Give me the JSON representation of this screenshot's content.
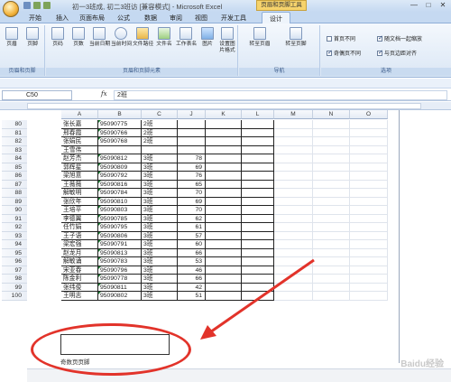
{
  "window": {
    "title": "初一3班成, 初二3班访 [兼容模式] - Microsoft Excel",
    "context_tab_title": "页眉和页脚工具",
    "min": "—",
    "max": "□",
    "close": "✕"
  },
  "tabs": [
    "开始",
    "插入",
    "页面布局",
    "公式",
    "数据",
    "审阅",
    "视图",
    "开发工具",
    "设计"
  ],
  "ribbon": {
    "groups": {
      "hf_label": "页眉和页脚",
      "elements_label": "页眉和页脚元素",
      "nav_label": "导航",
      "options_label": "选项"
    },
    "hf_buttons": [
      "页眉",
      "页脚"
    ],
    "element_buttons": [
      "页码",
      "页数",
      "当前日期",
      "当前时间",
      "文件路径",
      "文件名",
      "工作表名",
      "图片",
      "设置图片格式"
    ],
    "nav_buttons": [
      "转至页眉",
      "转至页脚"
    ],
    "options": [
      {
        "label": "首页不同",
        "checked": false
      },
      {
        "label": "随文档一起缩放",
        "checked": true
      },
      {
        "label": "奇偶页不同",
        "checked": true
      },
      {
        "label": "与页边距对齐",
        "checked": true
      }
    ]
  },
  "formula_bar": {
    "name_box": "C50",
    "fx": "fx",
    "content": "2班"
  },
  "columns": [
    "A",
    "B",
    "C",
    "J",
    "K",
    "L",
    "M",
    "N",
    "O"
  ],
  "rows": [
    {
      "n": "80",
      "name": "张长嘉",
      "id": "95090775",
      "cls": "2班",
      "score": ""
    },
    {
      "n": "81",
      "name": "邢春霞",
      "id": "95090766",
      "cls": "2班",
      "score": ""
    },
    {
      "n": "82",
      "name": "张娟民",
      "id": "95090768",
      "cls": "2班",
      "score": ""
    },
    {
      "n": "83",
      "name": "王雪伟",
      "id": "",
      "cls": "",
      "score": ""
    },
    {
      "n": "84",
      "name": "赵芳杰",
      "id": "95090812",
      "cls": "3班",
      "score": "78"
    },
    {
      "n": "85",
      "name": "郭辉星",
      "id": "95090809",
      "cls": "3班",
      "score": "69"
    },
    {
      "n": "86",
      "name": "梁旭意",
      "id": "95090792",
      "cls": "3班",
      "score": "76"
    },
    {
      "n": "87",
      "name": "王薇薇",
      "id": "95090816",
      "cls": "3班",
      "score": "65"
    },
    {
      "n": "88",
      "name": "解敏明",
      "id": "95090784",
      "cls": "3班",
      "score": "70"
    },
    {
      "n": "89",
      "name": "张欣年",
      "id": "95090810",
      "cls": "3班",
      "score": "69"
    },
    {
      "n": "90",
      "name": "王培平",
      "id": "95090803",
      "cls": "3班",
      "score": "70"
    },
    {
      "n": "91",
      "name": "李德翼",
      "id": "95090785",
      "cls": "3班",
      "score": "62"
    },
    {
      "n": "92",
      "name": "任竹娟",
      "id": "95090795",
      "cls": "3班",
      "score": "61"
    },
    {
      "n": "93",
      "name": "王子语",
      "id": "95090806",
      "cls": "3班",
      "score": "57"
    },
    {
      "n": "94",
      "name": "梁宏强",
      "id": "95090791",
      "cls": "3班",
      "score": "60"
    },
    {
      "n": "95",
      "name": "赵龙月",
      "id": "95090813",
      "cls": "3班",
      "score": "66"
    },
    {
      "n": "96",
      "name": "解敏诵",
      "id": "95090783",
      "cls": "3班",
      "score": "53"
    },
    {
      "n": "97",
      "name": "宋亚春",
      "id": "95090796",
      "cls": "3班",
      "score": "46"
    },
    {
      "n": "98",
      "name": "陈金利",
      "id": "95090778",
      "cls": "3班",
      "score": "66"
    },
    {
      "n": "99",
      "name": "张纬俊",
      "id": "95090811",
      "cls": "3班",
      "score": "42"
    },
    {
      "n": "100",
      "name": "王明志",
      "id": "95090802",
      "cls": "3班",
      "score": "51"
    }
  ],
  "footer": {
    "label": "奇数页页脚"
  },
  "watermark": "Baidu经验"
}
